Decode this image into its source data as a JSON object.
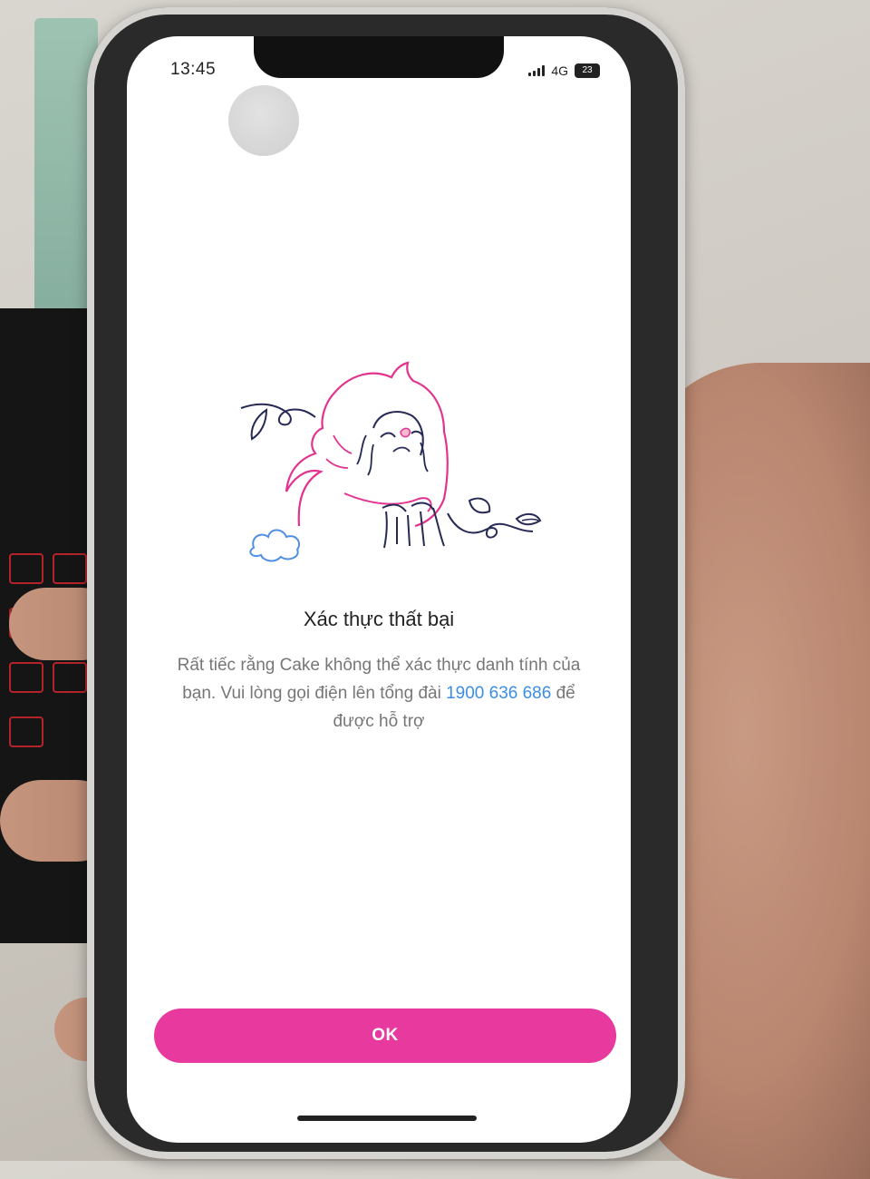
{
  "status_bar": {
    "time": "13:45",
    "network": "4G",
    "battery": "23"
  },
  "dialog": {
    "title": "Xác thực thất bại",
    "message_before_phone": "Rất tiếc rằng Cake không thể xác thực danh tính của bạn. Vui lòng gọi điện lên tổng đài",
    "phone_number": "1900 636 686",
    "message_after_phone": "để được hỗ trợ",
    "illustration": "sad-character-illustration"
  },
  "actions": {
    "ok_label": "OK"
  },
  "colors": {
    "accent": "#e8399f",
    "link": "#3b8ee6",
    "illustration_pink": "#e2338f",
    "illustration_navy": "#262a55",
    "illustration_blue": "#4f8fe6"
  }
}
